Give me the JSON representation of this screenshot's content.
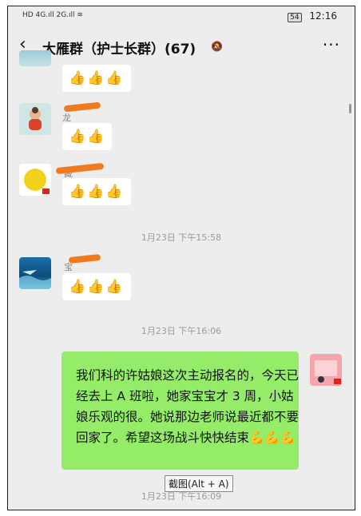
{
  "status_bar": {
    "left_indicators": "HD 4G.ıll 2G.ıll ≋",
    "battery": "54",
    "time": "12:16"
  },
  "header": {
    "back_icon": "‹",
    "title": "大雁群（护士长群）(67)",
    "muted_icon": "bell-off",
    "more_icon": "···"
  },
  "messages": [
    {
      "type": "reaction",
      "content": "👍👍👍"
    },
    {
      "type": "reaction",
      "sender_visible": "龙",
      "content": "👍👍"
    },
    {
      "type": "reaction",
      "sender_visible": "藏",
      "content": "👍👍👍"
    },
    {
      "type": "timestamp",
      "text": "1月23日 下午15:58"
    },
    {
      "type": "reaction",
      "sender_visible": "宝",
      "content": "👍👍👍"
    },
    {
      "type": "timestamp",
      "text": "1月23日 下午16:06"
    },
    {
      "type": "text_self",
      "text": "我们科的许姑娘这次主动报名的，今天已经去上 A 班啦，她家宝宝才 3 周，小姑娘乐观的很。她说那边老师说最近都不要回家了。希望这场战斗快快结束💪💪💪"
    },
    {
      "type": "timestamp",
      "text": "1月23日 下午16:09"
    }
  ],
  "tooltip": "截图(Alt + A)"
}
